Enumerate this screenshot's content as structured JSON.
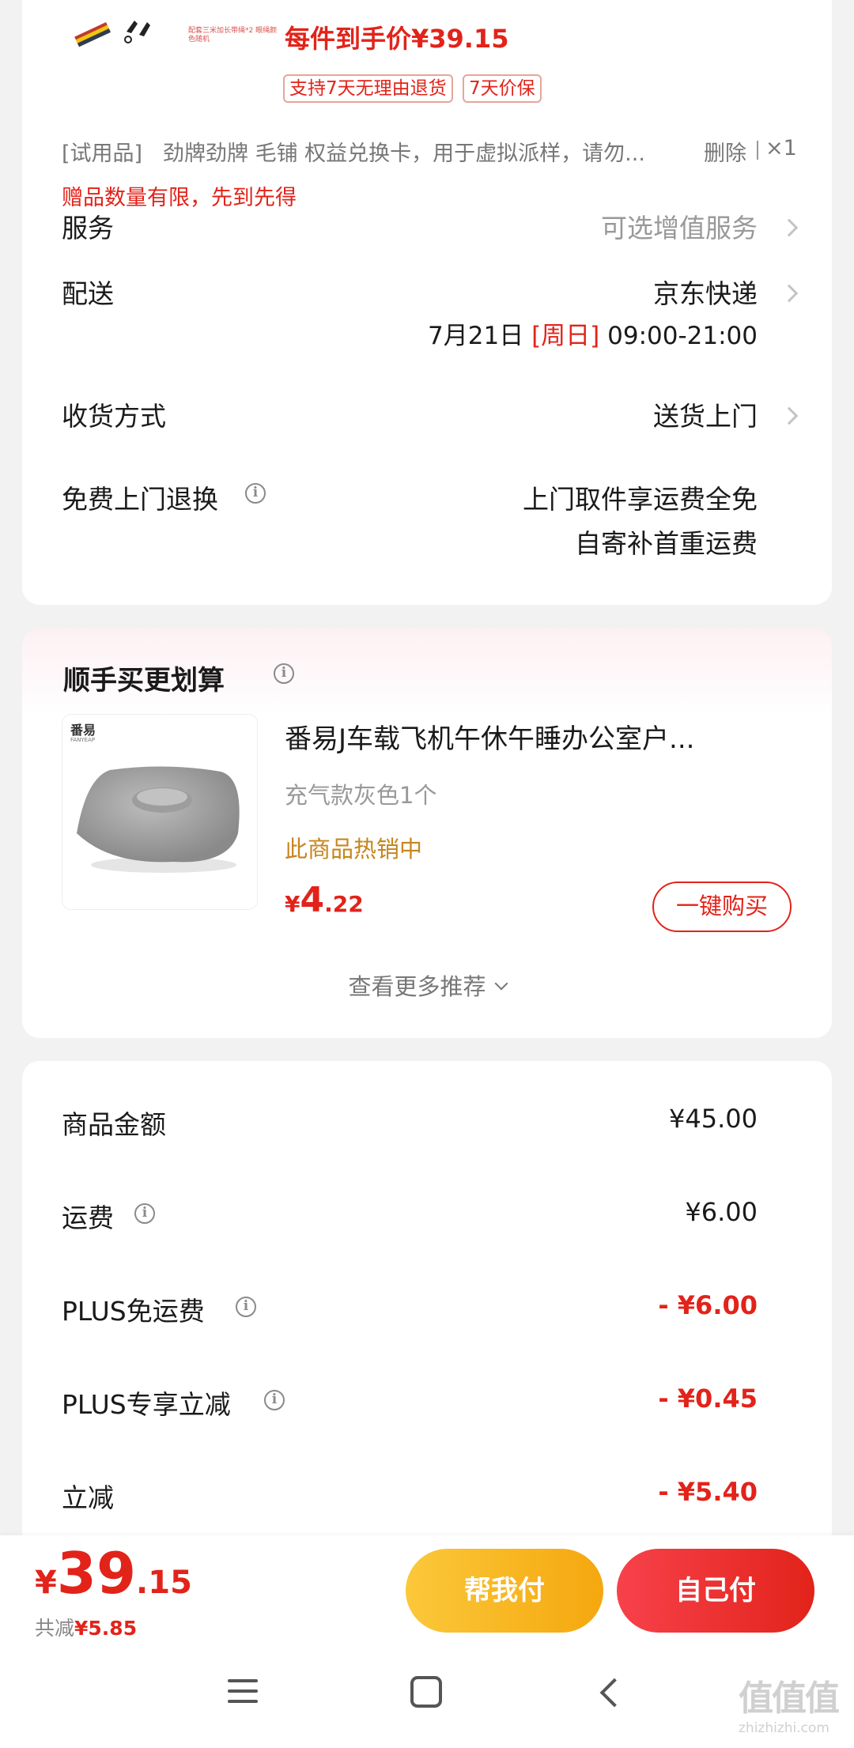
{
  "product": {
    "unit_price_label": "每件到手价¥39.15",
    "thumb_banner_text": "配套三米加长带绳*2 眼绳颜色随机",
    "tags": [
      "支持7天无理由退货",
      "7天价保"
    ]
  },
  "gift": {
    "prefix": "[试用品]",
    "title": "劲牌劲牌 毛铺 权益兑换卡，用于虚拟派样，请勿...",
    "delete_label": "删除",
    "quantity": "×1",
    "notice": "赠品数量有限，先到先得"
  },
  "service": {
    "label": "服务",
    "value": "可选增值服务"
  },
  "delivery": {
    "label": "配送",
    "carrier": "京东快递",
    "date": "7月21日",
    "weekday": "[周日]",
    "time": "09:00-21:00"
  },
  "receive": {
    "label": "收货方式",
    "value": "送货上门"
  },
  "free_return": {
    "label": "免费上门退换",
    "line1": "上门取件享运费全免",
    "line2": "自寄补首重运费"
  },
  "recommend": {
    "title": "顺手买更划算",
    "item": {
      "brand_cn": "番易",
      "brand_en": "FANYEAP",
      "name": "番易J车载飞机午休午睡办公室户...",
      "spec": "充气款灰色1个",
      "hot": "此商品热销中",
      "price_symbol": "¥",
      "price_int": "4",
      "price_dec": ".22",
      "buy_button": "一键购买"
    },
    "more": "查看更多推荐"
  },
  "summary": {
    "rows": [
      {
        "label": "商品金额",
        "value": "¥45.00"
      },
      {
        "label": "运费",
        "value": "¥6.00"
      },
      {
        "label": "PLUS免运费",
        "value": "- ¥6.00"
      },
      {
        "label": "PLUS专享立减",
        "value": "- ¥0.45"
      },
      {
        "label": "立减",
        "value": "- ¥5.40"
      }
    ]
  },
  "bottom_bar": {
    "symbol": "¥",
    "total_int": "39",
    "total_dec": ".15",
    "saved_prefix": "共减",
    "saved_value": "¥5.85",
    "help_pay": "帮我付",
    "self_pay": "自己付"
  },
  "watermark": {
    "text": "值值值",
    "url": "zhizhizhi.com"
  },
  "colors": {
    "accent_red": "#e2231a",
    "gold": "#f7b417",
    "hot_orange": "#c7851d"
  }
}
